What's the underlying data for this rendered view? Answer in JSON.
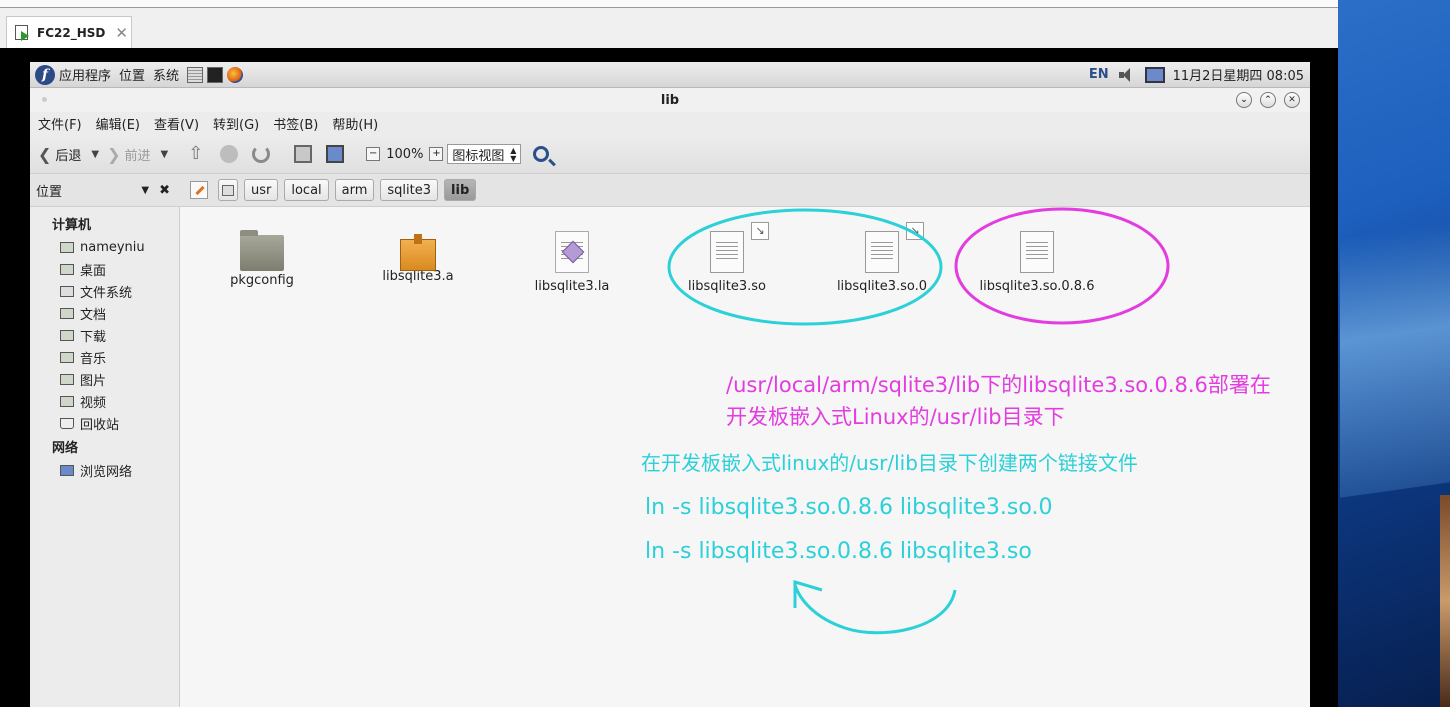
{
  "host": {
    "tab_title": "FC22_HSD",
    "tab_close": "✕"
  },
  "panel": {
    "logo": "f",
    "menus": [
      "应用程序",
      "位置",
      "系统"
    ],
    "lang": "EN",
    "clock": "11月2日星期四 08:05"
  },
  "window": {
    "title": "lib",
    "buttons": {
      "minimize": "⌄",
      "maximize": "⌃",
      "close": "✕"
    }
  },
  "menubar": [
    "文件(F)",
    "编辑(E)",
    "查看(V)",
    "转到(G)",
    "书签(B)",
    "帮助(H)"
  ],
  "toolbar": {
    "back": "后退",
    "forward": "前进",
    "zoom_out": "−",
    "zoom": "100%",
    "zoom_in": "+",
    "view_mode": "图标视图"
  },
  "location": {
    "sidebar_title": "位置",
    "crumbs": [
      "usr",
      "local",
      "arm",
      "sqlite3",
      "lib"
    ]
  },
  "sidebar": {
    "computer_heading": "计算机",
    "items": [
      "nameyniu",
      "桌面",
      "文件系统",
      "文档",
      "下载",
      "音乐",
      "图片",
      "视频",
      "回收站"
    ],
    "network_heading": "网络",
    "network_items": [
      "浏览网络"
    ]
  },
  "files": [
    {
      "name": "pkgconfig",
      "icon": "folder-icon"
    },
    {
      "name": "libsqlite3.a",
      "icon": "archive-icon"
    },
    {
      "name": "libsqlite3.la",
      "icon": "libtool-icon"
    },
    {
      "name": "libsqlite3.so",
      "icon": "symlink-file-icon"
    },
    {
      "name": "libsqlite3.so.0",
      "icon": "symlink-file-icon"
    },
    {
      "name": "libsqlite3.so.0.8.6",
      "icon": "file-icon"
    }
  ],
  "annotations": {
    "magenta_line1": "/usr/local/arm/sqlite3/lib下的libsqlite3.so.0.8.6部署在",
    "magenta_line2": "开发板嵌入式Linux的/usr/lib目录下",
    "cyan_desc": "在开发板嵌入式linux的/usr/lib目录下创建两个链接文件",
    "cmd1": "ln -s libsqlite3.so.0.8.6  libsqlite3.so.0",
    "cmd2": "ln -s libsqlite3.so.0.8.6  libsqlite3.so"
  },
  "colors": {
    "annotation_magenta": "#e33ce0",
    "annotation_cyan": "#2cd0d8"
  }
}
